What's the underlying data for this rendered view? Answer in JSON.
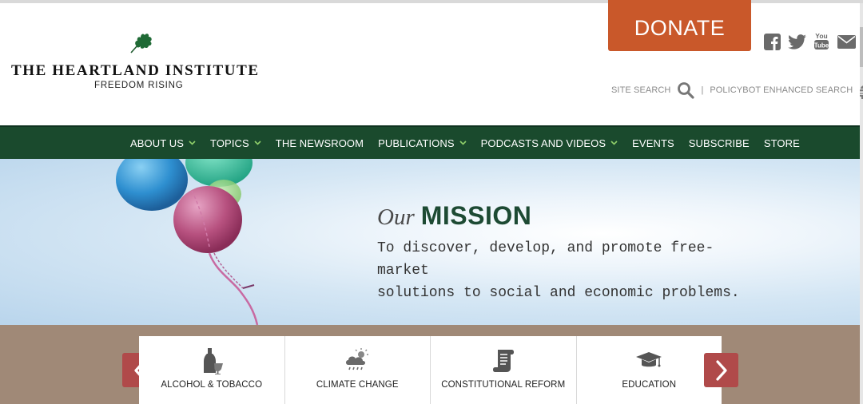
{
  "header": {
    "logo_title": "THE HEARTLAND INSTITUTE",
    "logo_subtitle": "FREEDOM RISING",
    "donate_label": "DONATE",
    "social_icons": [
      "facebook-icon",
      "twitter-icon",
      "youtube-icon",
      "email-icon"
    ],
    "site_search_label": "SITE SEARCH",
    "separator": "|",
    "policybot_label": "POLICYBOT ENHANCED SEARCH"
  },
  "nav": {
    "items": [
      {
        "label": "ABOUT US",
        "dropdown": true
      },
      {
        "label": "TOPICS",
        "dropdown": true
      },
      {
        "label": "THE NEWSROOM",
        "dropdown": false
      },
      {
        "label": "PUBLICATIONS",
        "dropdown": true
      },
      {
        "label": "PODCASTS AND VIDEOS",
        "dropdown": true
      },
      {
        "label": "EVENTS",
        "dropdown": false
      },
      {
        "label": "SUBSCRIBE",
        "dropdown": false
      },
      {
        "label": "STORE",
        "dropdown": false
      }
    ]
  },
  "hero": {
    "our": "Our",
    "title": "MISSION",
    "line1": "To discover, develop, and promote free-market",
    "line2": "solutions to social and economic problems."
  },
  "topics": {
    "cards": [
      {
        "label": "ALCOHOL & TOBACCO",
        "icon": "bottle-glass-icon"
      },
      {
        "label": "CLIMATE CHANGE",
        "icon": "cloud-rain-icon"
      },
      {
        "label": "CONSTITUTIONAL REFORM",
        "icon": "scroll-icon"
      },
      {
        "label": "EDUCATION",
        "icon": "graduation-cap-icon"
      }
    ]
  },
  "colors": {
    "accent_orange": "#c9582a",
    "nav_green": "#1a4a2d",
    "band_brown": "#a08977",
    "arrow_red": "#b04a4a"
  }
}
